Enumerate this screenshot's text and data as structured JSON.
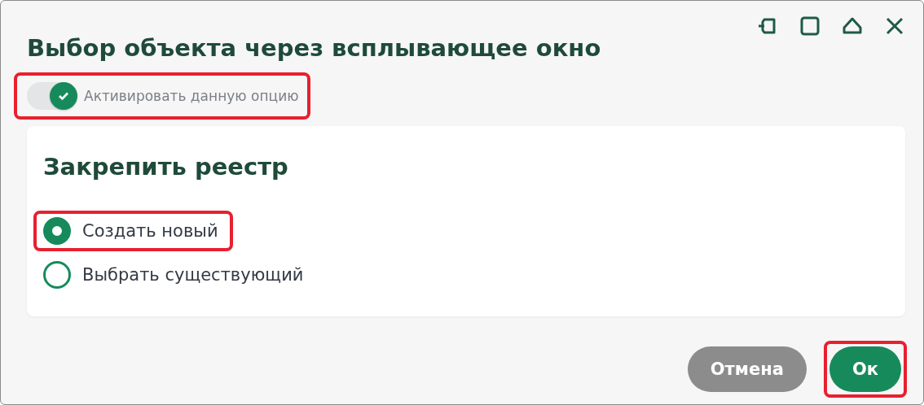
{
  "window": {
    "title": "Выбор объекта через всплывающее окно"
  },
  "toggle": {
    "label": "Активировать данную опцию",
    "on": true,
    "highlighted": true
  },
  "card": {
    "title": "Закрепить реестр",
    "options": [
      {
        "label": "Создать новый",
        "selected": true,
        "highlighted": true
      },
      {
        "label": "Выбрать существующий",
        "selected": false,
        "highlighted": false
      }
    ]
  },
  "buttons": [
    {
      "label": "Отмена",
      "kind": "secondary",
      "highlighted": false
    },
    {
      "label": "Ок",
      "kind": "primary",
      "highlighted": true
    }
  ]
}
